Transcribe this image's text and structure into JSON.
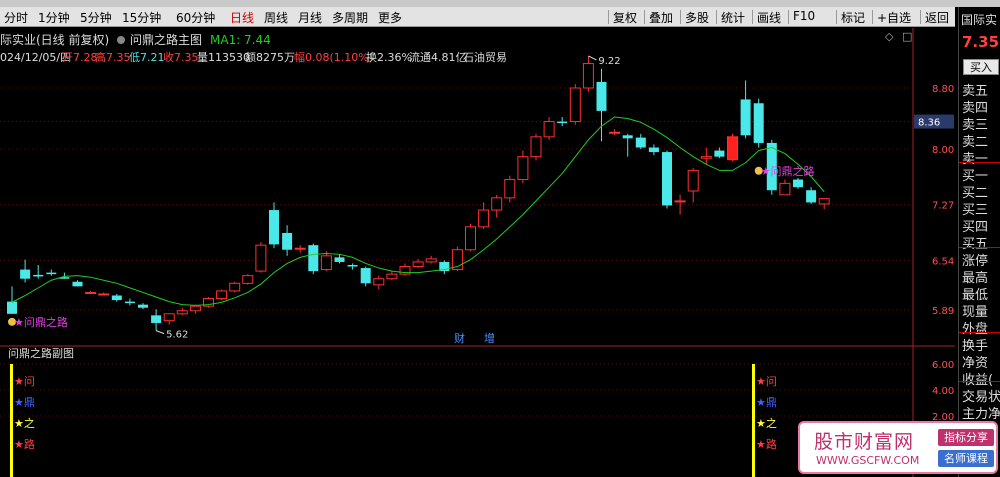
{
  "toolbar": {
    "left": [
      {
        "key": "fenshi",
        "label": "分时"
      },
      {
        "key": "1m",
        "label": "1分钟"
      },
      {
        "key": "5m",
        "label": "5分钟"
      },
      {
        "key": "15m",
        "label": "15分钟"
      },
      {
        "key": "60m",
        "label": "60分钟"
      },
      {
        "key": "day",
        "label": "日线",
        "active": true
      },
      {
        "key": "week",
        "label": "周线"
      },
      {
        "key": "month",
        "label": "月线"
      },
      {
        "key": "multi",
        "label": "多周期"
      },
      {
        "key": "more",
        "label": "更多"
      }
    ],
    "right": [
      {
        "key": "fuquan",
        "label": "复权"
      },
      {
        "key": "diejia",
        "label": "叠加"
      },
      {
        "key": "duogu",
        "label": "多股"
      },
      {
        "key": "tongji",
        "label": "统计"
      },
      {
        "key": "huaxian",
        "label": "画线"
      },
      {
        "key": "f10",
        "label": "F10"
      },
      {
        "key": "biaoji",
        "label": "标记"
      },
      {
        "key": "zixuan",
        "label": "+自选"
      },
      {
        "key": "fanhui",
        "label": "返回"
      }
    ]
  },
  "header": {
    "line1": "际实业(日线 前复权)",
    "indicator_name": "问鼎之路主图",
    "ma_label": "MA1: 7.44",
    "date": "024/12/05/四",
    "open": "开7.28",
    "high": "高7.35",
    "low": "低7.21",
    "close": "收7.35",
    "volume": "量113530",
    "amount": "额8275万",
    "change": "幅0.08(1.10%)",
    "turnover": "换2.36%",
    "float": "流通4.81亿",
    "industry": "石油贸易"
  },
  "main_chart": {
    "price_axis": [
      "8.80",
      "8.36",
      "8.00",
      "7.27",
      "6.54",
      "5.89"
    ],
    "current_price_tag": "8.36",
    "high_marker": "9.22",
    "low_marker": "5.62",
    "signal_label": "问鼎之路",
    "bottom_markers": [
      "财",
      "增"
    ]
  },
  "chart_data": {
    "type": "candlestick",
    "title": "问鼎之路主图",
    "yrange": [
      5.5,
      9.4
    ],
    "candles": [
      {
        "o": 6.0,
        "h": 6.2,
        "l": 5.84,
        "c": 5.84
      },
      {
        "o": 6.42,
        "h": 6.55,
        "l": 6.25,
        "c": 6.3
      },
      {
        "o": 6.35,
        "h": 6.48,
        "l": 6.3,
        "c": 6.33
      },
      {
        "o": 6.38,
        "h": 6.42,
        "l": 6.34,
        "c": 6.36
      },
      {
        "o": 6.32,
        "h": 6.38,
        "l": 6.3,
        "c": 6.3
      },
      {
        "o": 6.26,
        "h": 6.28,
        "l": 6.2,
        "c": 6.2
      },
      {
        "o": 6.12,
        "h": 6.14,
        "l": 6.1,
        "c": 6.12
      },
      {
        "o": 6.1,
        "h": 6.12,
        "l": 6.08,
        "c": 6.1
      },
      {
        "o": 6.08,
        "h": 6.1,
        "l": 6.0,
        "c": 6.02
      },
      {
        "o": 6.0,
        "h": 6.04,
        "l": 5.95,
        "c": 5.98
      },
      {
        "o": 5.96,
        "h": 5.98,
        "l": 5.9,
        "c": 5.92
      },
      {
        "o": 5.82,
        "h": 5.9,
        "l": 5.62,
        "c": 5.72
      },
      {
        "o": 5.75,
        "h": 5.84,
        "l": 5.7,
        "c": 5.84
      },
      {
        "o": 5.84,
        "h": 5.92,
        "l": 5.82,
        "c": 5.88
      },
      {
        "o": 5.88,
        "h": 5.96,
        "l": 5.84,
        "c": 5.94
      },
      {
        "o": 5.94,
        "h": 6.06,
        "l": 5.92,
        "c": 6.04
      },
      {
        "o": 6.04,
        "h": 6.16,
        "l": 6.02,
        "c": 6.14
      },
      {
        "o": 6.14,
        "h": 6.26,
        "l": 6.12,
        "c": 6.24
      },
      {
        "o": 6.24,
        "h": 6.36,
        "l": 6.22,
        "c": 6.34
      },
      {
        "o": 6.4,
        "h": 6.78,
        "l": 6.38,
        "c": 6.74
      },
      {
        "o": 7.2,
        "h": 7.3,
        "l": 6.7,
        "c": 6.75
      },
      {
        "o": 6.9,
        "h": 7.0,
        "l": 6.6,
        "c": 6.68
      },
      {
        "o": 6.7,
        "h": 6.74,
        "l": 6.64,
        "c": 6.7
      },
      {
        "o": 6.74,
        "h": 6.76,
        "l": 6.36,
        "c": 6.4
      },
      {
        "o": 6.42,
        "h": 6.66,
        "l": 6.4,
        "c": 6.6
      },
      {
        "o": 6.58,
        "h": 6.62,
        "l": 6.5,
        "c": 6.52
      },
      {
        "o": 6.48,
        "h": 6.5,
        "l": 6.42,
        "c": 6.46
      },
      {
        "o": 6.44,
        "h": 6.46,
        "l": 6.2,
        "c": 6.24
      },
      {
        "o": 6.22,
        "h": 6.34,
        "l": 6.16,
        "c": 6.3
      },
      {
        "o": 6.3,
        "h": 6.4,
        "l": 6.28,
        "c": 6.36
      },
      {
        "o": 6.36,
        "h": 6.5,
        "l": 6.34,
        "c": 6.46
      },
      {
        "o": 6.46,
        "h": 6.56,
        "l": 6.44,
        "c": 6.52
      },
      {
        "o": 6.52,
        "h": 6.6,
        "l": 6.5,
        "c": 6.56
      },
      {
        "o": 6.52,
        "h": 6.54,
        "l": 6.36,
        "c": 6.4
      },
      {
        "o": 6.42,
        "h": 6.72,
        "l": 6.4,
        "c": 6.68
      },
      {
        "o": 6.68,
        "h": 7.02,
        "l": 6.66,
        "c": 6.98
      },
      {
        "o": 6.98,
        "h": 7.3,
        "l": 6.95,
        "c": 7.2
      },
      {
        "o": 7.2,
        "h": 7.4,
        "l": 7.1,
        "c": 7.36
      },
      {
        "o": 7.36,
        "h": 7.65,
        "l": 7.3,
        "c": 7.6
      },
      {
        "o": 7.6,
        "h": 7.98,
        "l": 7.55,
        "c": 7.9
      },
      {
        "o": 7.9,
        "h": 8.2,
        "l": 7.85,
        "c": 8.16
      },
      {
        "o": 8.16,
        "h": 8.42,
        "l": 8.12,
        "c": 8.36
      },
      {
        "o": 8.36,
        "h": 8.42,
        "l": 8.3,
        "c": 8.34
      },
      {
        "o": 8.36,
        "h": 8.85,
        "l": 8.32,
        "c": 8.8
      },
      {
        "o": 8.8,
        "h": 9.22,
        "l": 8.75,
        "c": 9.12
      },
      {
        "o": 8.88,
        "h": 9.05,
        "l": 8.1,
        "c": 8.5
      },
      {
        "o": 8.22,
        "h": 8.26,
        "l": 8.18,
        "c": 8.22
      },
      {
        "o": 8.18,
        "h": 8.2,
        "l": 7.9,
        "c": 8.14
      },
      {
        "o": 8.15,
        "h": 8.2,
        "l": 8.0,
        "c": 8.02
      },
      {
        "o": 8.02,
        "h": 8.06,
        "l": 7.92,
        "c": 7.96
      },
      {
        "o": 7.96,
        "h": 7.98,
        "l": 7.22,
        "c": 7.26
      },
      {
        "o": 7.32,
        "h": 7.4,
        "l": 7.14,
        "c": 7.32
      },
      {
        "o": 7.45,
        "h": 7.75,
        "l": 7.3,
        "c": 7.72
      },
      {
        "o": 7.88,
        "h": 8.02,
        "l": 7.8,
        "c": 7.9
      },
      {
        "o": 7.98,
        "h": 8.02,
        "l": 7.88,
        "c": 7.9
      },
      {
        "o": 7.86,
        "h": 8.2,
        "l": 7.84,
        "c": 8.16
      },
      {
        "o": 8.65,
        "h": 8.9,
        "l": 8.14,
        "c": 8.18
      },
      {
        "o": 8.6,
        "h": 8.66,
        "l": 8.02,
        "c": 8.08
      },
      {
        "o": 8.08,
        "h": 8.12,
        "l": 7.4,
        "c": 7.46
      },
      {
        "o": 7.4,
        "h": 7.6,
        "l": 7.4,
        "c": 7.55
      },
      {
        "o": 7.6,
        "h": 7.62,
        "l": 7.48,
        "c": 7.5
      },
      {
        "o": 7.46,
        "h": 7.5,
        "l": 7.28,
        "c": 7.3
      },
      {
        "o": 7.28,
        "h": 7.35,
        "l": 7.21,
        "c": 7.35
      }
    ],
    "ma1": [
      5.99,
      6.08,
      6.18,
      6.28,
      6.33,
      6.34,
      6.32,
      6.28,
      6.24,
      6.18,
      6.12,
      6.06,
      6.0,
      5.96,
      5.95,
      5.96,
      5.99,
      6.05,
      6.12,
      6.23,
      6.38,
      6.5,
      6.58,
      6.62,
      6.63,
      6.62,
      6.58,
      6.5,
      6.44,
      6.4,
      6.38,
      6.38,
      6.4,
      6.42,
      6.46,
      6.55,
      6.68,
      6.82,
      6.98,
      7.14,
      7.32,
      7.5,
      7.68,
      7.9,
      8.12,
      8.3,
      8.42,
      8.4,
      8.35,
      8.26,
      8.15,
      8.02,
      7.9,
      7.8,
      7.72,
      7.72,
      7.82,
      7.98,
      8.02,
      7.94,
      7.8,
      7.64,
      7.44
    ]
  },
  "sub_chart": {
    "title": "问鼎之路副图",
    "axis": [
      "6.00",
      "4.00",
      "2.00"
    ],
    "stars": [
      {
        "label": "问",
        "color": "#ff4040"
      },
      {
        "label": "鼎",
        "color": "#4060ff"
      },
      {
        "label": "之",
        "color": "#ffff40"
      },
      {
        "label": "路",
        "color": "#ff4040"
      }
    ]
  },
  "right_panel": {
    "title": "国际实",
    "price": "7.35",
    "buy": "买入",
    "sell": [
      "卖五",
      "卖四",
      "卖三",
      "卖二",
      "卖一"
    ],
    "buy_levels": [
      "买一",
      "买二",
      "买三",
      "买四",
      "买五"
    ],
    "stats": [
      "涨停",
      "最高",
      "最低",
      "现量",
      "外盘",
      "换手",
      "净资",
      "收益(",
      "交易状",
      "主力净"
    ]
  },
  "watermark": {
    "main": "股市财富网",
    "url": "WWW.GSCFW.COM",
    "tag1": "指标分享",
    "tag2": "名师课程"
  }
}
